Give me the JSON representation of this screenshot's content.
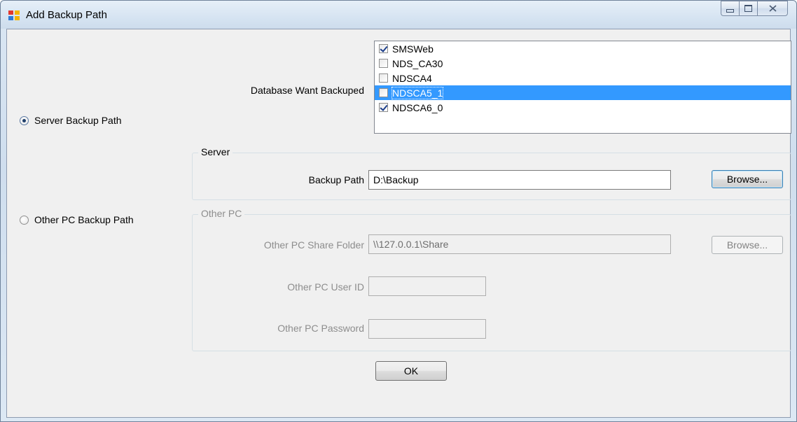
{
  "window": {
    "title": "Add Backup Path"
  },
  "radios": {
    "server": {
      "label": "Server Backup Path",
      "checked": true
    },
    "other": {
      "label": "Other PC Backup Path",
      "checked": false
    }
  },
  "database": {
    "label": "Database Want Backuped",
    "items": [
      {
        "name": "SMSWeb",
        "checked": true,
        "selected": false
      },
      {
        "name": "NDS_CA30",
        "checked": false,
        "selected": false
      },
      {
        "name": "NDSCA4",
        "checked": false,
        "selected": false
      },
      {
        "name": "NDSCA5_1",
        "checked": false,
        "selected": true
      },
      {
        "name": "NDSCA6_0",
        "checked": true,
        "selected": false
      }
    ]
  },
  "server_group": {
    "legend": "Server",
    "backup_path_label": "Backup Path",
    "backup_path_value": "D:\\Backup",
    "browse_label": "Browse..."
  },
  "other_group": {
    "legend": "Other PC",
    "share_folder_label": "Other PC Share Folder",
    "share_folder_value": "\\\\127.0.0.1\\Share",
    "browse_label": "Browse...",
    "user_id_label": "Other PC User ID",
    "user_id_value": "",
    "password_label": "Other PC Password",
    "password_value": ""
  },
  "ok_label": "OK"
}
